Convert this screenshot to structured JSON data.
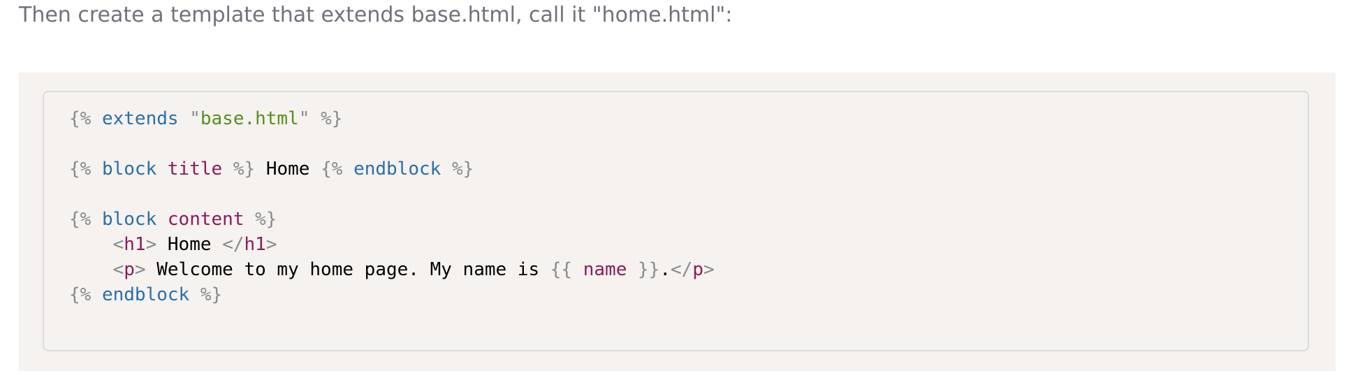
{
  "intro_text": "Then create a template that extends base.html, call it \"home.html\":",
  "code": {
    "line1": {
      "open": "{%",
      "kw": "extends",
      "q1": "\"",
      "str": "base.html",
      "q2": "\"",
      "close": "%}"
    },
    "line2": {
      "open1": "{%",
      "kw1": "block",
      "name": "title",
      "close1": "%}",
      "text": "Home",
      "open2": "{%",
      "kw2": "endblock",
      "close2": "%}"
    },
    "line3": {
      "open": "{%",
      "kw": "block",
      "name": "content",
      "close": "%}"
    },
    "line4": {
      "lt1": "<",
      "tag1": "h1",
      "gt1": ">",
      "text": "Home",
      "lt2": "</",
      "tag2": "h1",
      "gt2": ">"
    },
    "line5": {
      "lt1": "<",
      "tag1": "p",
      "gt1": ">",
      "text": "Welcome to my home page. My name is",
      "open": "{{",
      "var": "name",
      "close": "}}",
      "dot": ".",
      "lt2": "</",
      "tag2": "p",
      "gt2": ">"
    },
    "line6": {
      "open": "{%",
      "kw": "endblock",
      "close": "%}"
    }
  },
  "colors": {
    "delimiter": "#8a8a8a",
    "keyword": "#2d6ea6",
    "string": "#5b8d1e",
    "name": "#8b1c5a",
    "background": "#f5f2ef"
  }
}
